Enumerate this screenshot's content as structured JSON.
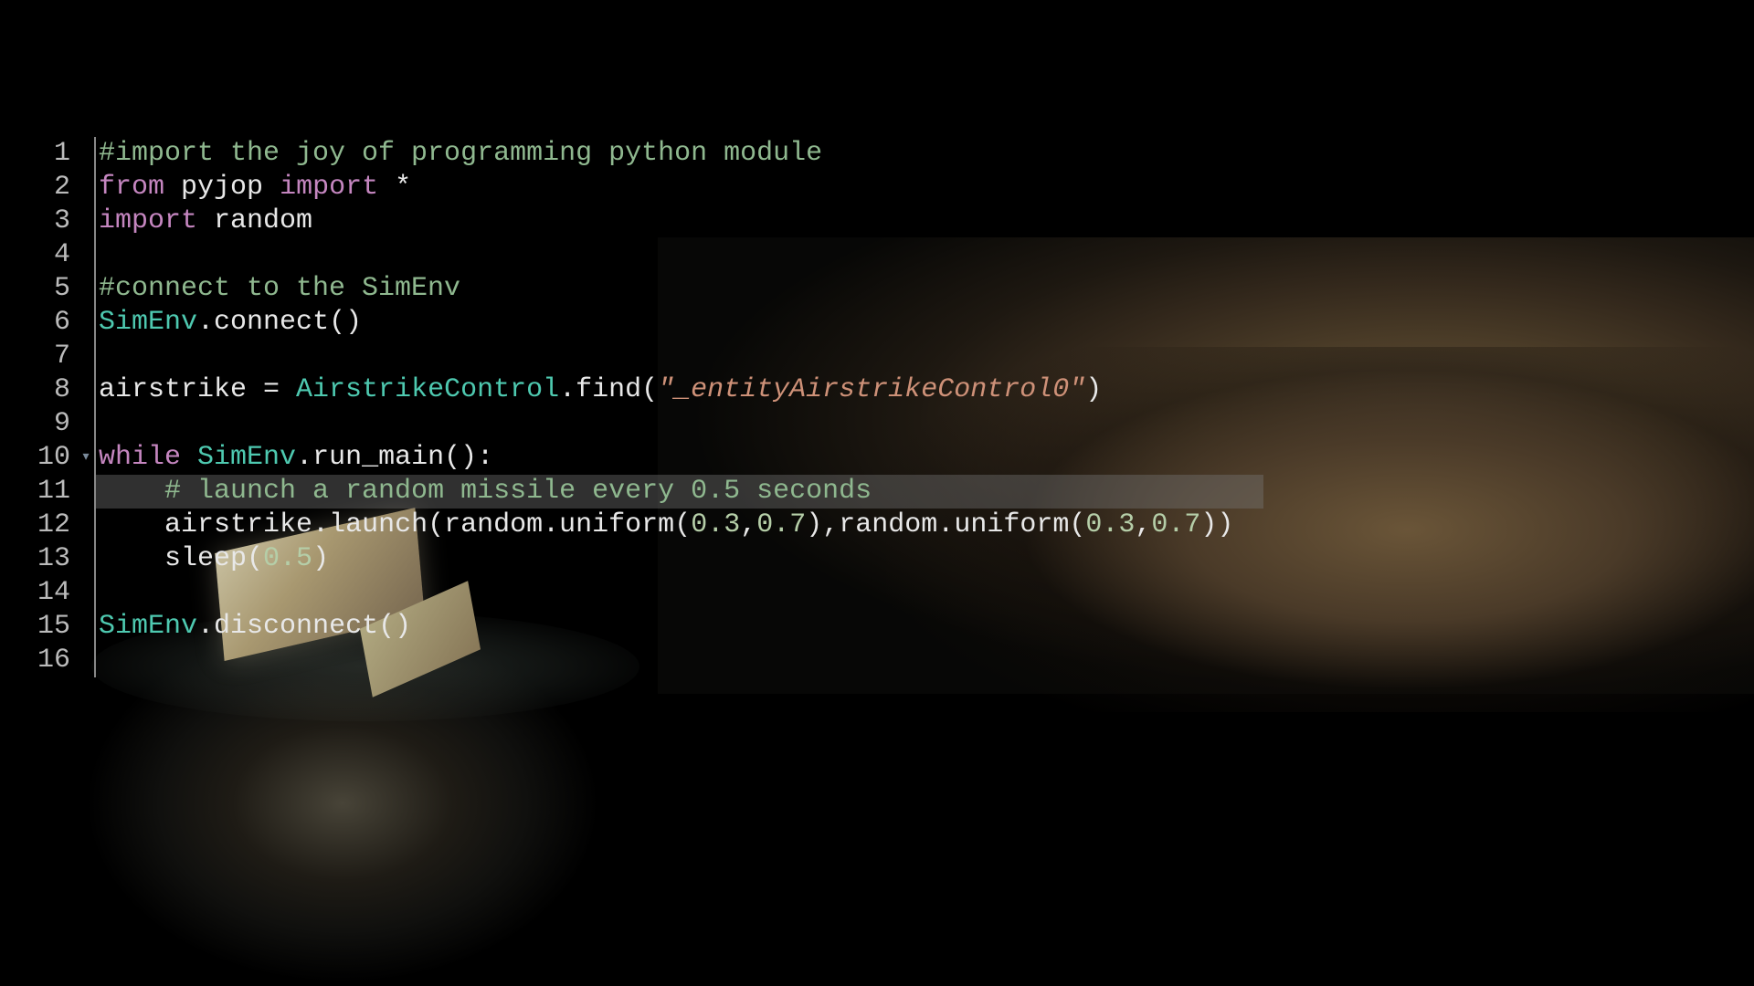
{
  "editor": {
    "highlighted_line": 11,
    "fold_marker_line": 10,
    "lines": [
      {
        "num": "1",
        "tokens": [
          {
            "cls": "tok-comment",
            "text": "#import the joy of programming python module"
          }
        ]
      },
      {
        "num": "2",
        "tokens": [
          {
            "cls": "tok-keyword",
            "text": "from"
          },
          {
            "cls": "tok-punct",
            "text": " "
          },
          {
            "cls": "tok-module",
            "text": "pyjop"
          },
          {
            "cls": "tok-punct",
            "text": " "
          },
          {
            "cls": "tok-keyword",
            "text": "import"
          },
          {
            "cls": "tok-punct",
            "text": " "
          },
          {
            "cls": "tok-star",
            "text": "*"
          }
        ]
      },
      {
        "num": "3",
        "tokens": [
          {
            "cls": "tok-keyword",
            "text": "import"
          },
          {
            "cls": "tok-punct",
            "text": " "
          },
          {
            "cls": "tok-module",
            "text": "random"
          }
        ]
      },
      {
        "num": "4",
        "tokens": []
      },
      {
        "num": "5",
        "tokens": [
          {
            "cls": "tok-comment",
            "text": "#connect to the SimEnv"
          }
        ]
      },
      {
        "num": "6",
        "tokens": [
          {
            "cls": "tok-class",
            "text": "SimEnv"
          },
          {
            "cls": "tok-punct",
            "text": "."
          },
          {
            "cls": "tok-method",
            "text": "connect"
          },
          {
            "cls": "tok-punct",
            "text": "()"
          }
        ]
      },
      {
        "num": "7",
        "tokens": []
      },
      {
        "num": "8",
        "tokens": [
          {
            "cls": "tok-var",
            "text": "airstrike"
          },
          {
            "cls": "tok-punct",
            "text": " = "
          },
          {
            "cls": "tok-class",
            "text": "AirstrikeControl"
          },
          {
            "cls": "tok-punct",
            "text": "."
          },
          {
            "cls": "tok-method",
            "text": "find"
          },
          {
            "cls": "tok-punct",
            "text": "("
          },
          {
            "cls": "tok-string",
            "text": "\"_entityAirstrikeControl0\""
          },
          {
            "cls": "tok-punct",
            "text": ")"
          }
        ]
      },
      {
        "num": "9",
        "tokens": []
      },
      {
        "num": "10",
        "tokens": [
          {
            "cls": "tok-keyword",
            "text": "while"
          },
          {
            "cls": "tok-punct",
            "text": " "
          },
          {
            "cls": "tok-class",
            "text": "SimEnv"
          },
          {
            "cls": "tok-punct",
            "text": "."
          },
          {
            "cls": "tok-method",
            "text": "run_main"
          },
          {
            "cls": "tok-punct",
            "text": "():"
          }
        ]
      },
      {
        "num": "11",
        "tokens": [
          {
            "cls": "tok-punct",
            "text": "    "
          },
          {
            "cls": "tok-comment",
            "text": "# launch a random missile every 0.5 seconds"
          }
        ]
      },
      {
        "num": "12",
        "tokens": [
          {
            "cls": "tok-punct",
            "text": "    "
          },
          {
            "cls": "tok-var",
            "text": "airstrike"
          },
          {
            "cls": "tok-punct",
            "text": "."
          },
          {
            "cls": "tok-method",
            "text": "launch"
          },
          {
            "cls": "tok-punct",
            "text": "("
          },
          {
            "cls": "tok-var",
            "text": "random"
          },
          {
            "cls": "tok-punct",
            "text": "."
          },
          {
            "cls": "tok-method",
            "text": "uniform"
          },
          {
            "cls": "tok-punct",
            "text": "("
          },
          {
            "cls": "tok-number",
            "text": "0.3"
          },
          {
            "cls": "tok-punct",
            "text": ","
          },
          {
            "cls": "tok-number",
            "text": "0.7"
          },
          {
            "cls": "tok-punct",
            "text": "),"
          },
          {
            "cls": "tok-var",
            "text": "random"
          },
          {
            "cls": "tok-punct",
            "text": "."
          },
          {
            "cls": "tok-method",
            "text": "uniform"
          },
          {
            "cls": "tok-punct",
            "text": "("
          },
          {
            "cls": "tok-number",
            "text": "0.3"
          },
          {
            "cls": "tok-punct",
            "text": ","
          },
          {
            "cls": "tok-number",
            "text": "0.7"
          },
          {
            "cls": "tok-punct",
            "text": "))"
          }
        ]
      },
      {
        "num": "13",
        "tokens": [
          {
            "cls": "tok-punct",
            "text": "    "
          },
          {
            "cls": "tok-func",
            "text": "sleep"
          },
          {
            "cls": "tok-punct",
            "text": "("
          },
          {
            "cls": "tok-number",
            "text": "0.5"
          },
          {
            "cls": "tok-punct",
            "text": ")"
          }
        ]
      },
      {
        "num": "14",
        "tokens": []
      },
      {
        "num": "15",
        "tokens": [
          {
            "cls": "tok-class",
            "text": "SimEnv"
          },
          {
            "cls": "tok-punct",
            "text": "."
          },
          {
            "cls": "tok-method",
            "text": "disconnect"
          },
          {
            "cls": "tok-punct",
            "text": "()"
          }
        ]
      },
      {
        "num": "16",
        "tokens": []
      }
    ]
  },
  "fold_marker_glyph": "▾"
}
